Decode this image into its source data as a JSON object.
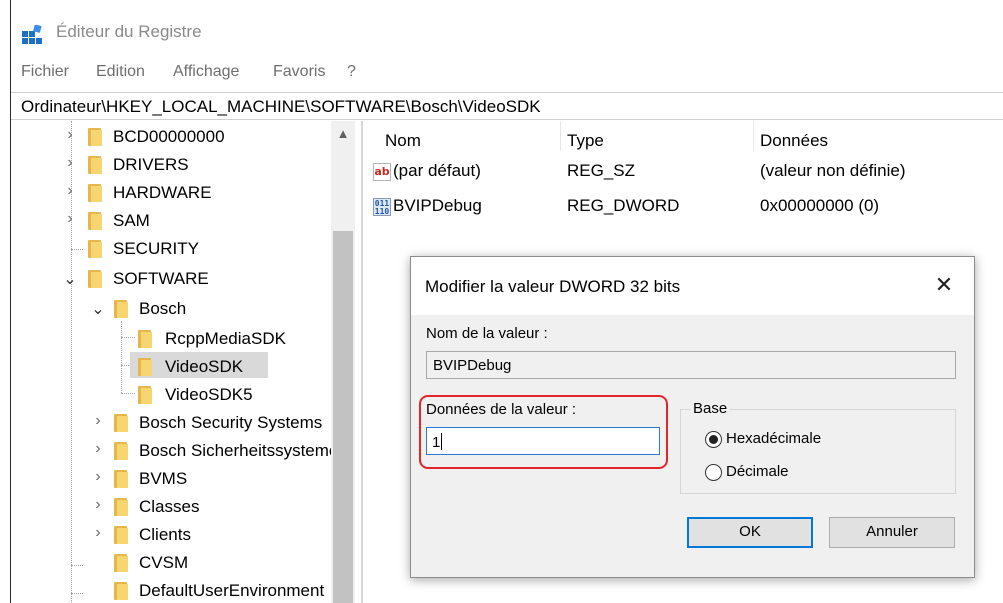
{
  "window": {
    "title": "Éditeur du Registre"
  },
  "menu": {
    "items": [
      "Fichier",
      "Edition",
      "Affichage",
      "Favoris",
      "?"
    ]
  },
  "address": {
    "path": "Ordinateur\\HKEY_LOCAL_MACHINE\\SOFTWARE\\Bosch\\VideoSDK"
  },
  "tree": {
    "items": [
      {
        "label": "BCD00000000",
        "expander": "collapsed"
      },
      {
        "label": "DRIVERS",
        "expander": "collapsed"
      },
      {
        "label": "HARDWARE",
        "expander": "collapsed"
      },
      {
        "label": "SAM",
        "expander": "collapsed"
      },
      {
        "label": "SECURITY",
        "expander": "none"
      },
      {
        "label": "SOFTWARE",
        "expander": "expanded"
      },
      {
        "label": "Bosch",
        "expander": "expanded"
      },
      {
        "label": "RcppMediaSDK",
        "expander": "none"
      },
      {
        "label": "VideoSDK",
        "expander": "none",
        "selected": true
      },
      {
        "label": "VideoSDK5",
        "expander": "none"
      },
      {
        "label": "Bosch Security Systems",
        "expander": "collapsed"
      },
      {
        "label": "Bosch Sicherheitssysteme",
        "expander": "collapsed"
      },
      {
        "label": "BVMS",
        "expander": "collapsed"
      },
      {
        "label": "Classes",
        "expander": "collapsed"
      },
      {
        "label": "Clients",
        "expander": "collapsed"
      },
      {
        "label": "CVSM",
        "expander": "none"
      },
      {
        "label": "DefaultUserEnvironment",
        "expander": "none"
      }
    ]
  },
  "list": {
    "headers": {
      "name": "Nom",
      "type": "Type",
      "data": "Données"
    },
    "rows": [
      {
        "icon": "string-value-icon",
        "name": "(par défaut)",
        "type": "REG_SZ",
        "data": "(valeur non définie)"
      },
      {
        "icon": "binary-value-icon",
        "name": "BVIPDebug",
        "type": "REG_DWORD",
        "data": "0x00000000 (0)"
      }
    ]
  },
  "dialog": {
    "title": "Modifier la valeur DWORD 32 bits",
    "close_glyph": "✕",
    "value_name_label": "Nom de la valeur :",
    "value_name": "BVIPDebug",
    "value_data_label": "Données de la valeur :",
    "value_data": "1",
    "base_label": "Base",
    "base_options": [
      "Hexadécimale",
      "Décimale"
    ],
    "base_selected": "Hexadécimale",
    "ok_label": "OK",
    "cancel_label": "Annuler",
    "highlight_color": "#e0262a"
  }
}
